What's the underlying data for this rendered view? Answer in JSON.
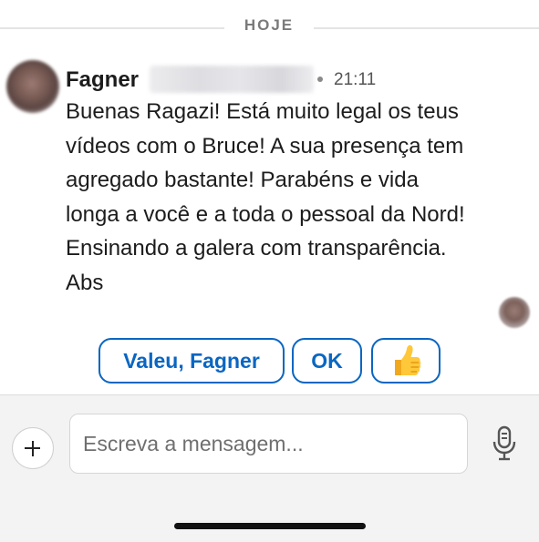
{
  "divider": {
    "label": "HOJE"
  },
  "message": {
    "sender_first_name": "Fagner",
    "time": "21:11",
    "text": "Buenas Ragazi! Está muito legal os teus\nvídeos com o Bruce! A sua presença tem\nagregado bastante! Parabéns e vida\nlonga a você e a toda o pessoal da Nord!\nEnsinando a galera com transparência.\nAbs"
  },
  "quick_replies": {
    "reply_1": "Valeu, Fagner",
    "reply_2": "OK",
    "reply_3_icon": "thumbs-up-emoji"
  },
  "composer": {
    "placeholder": "Escreva a mensagem...",
    "add_icon": "plus-icon",
    "mic_icon": "microphone-icon"
  },
  "colors": {
    "accent": "#0a66c2",
    "divider_text": "#7a7a7a",
    "composer_bg": "#f3f3f4"
  }
}
